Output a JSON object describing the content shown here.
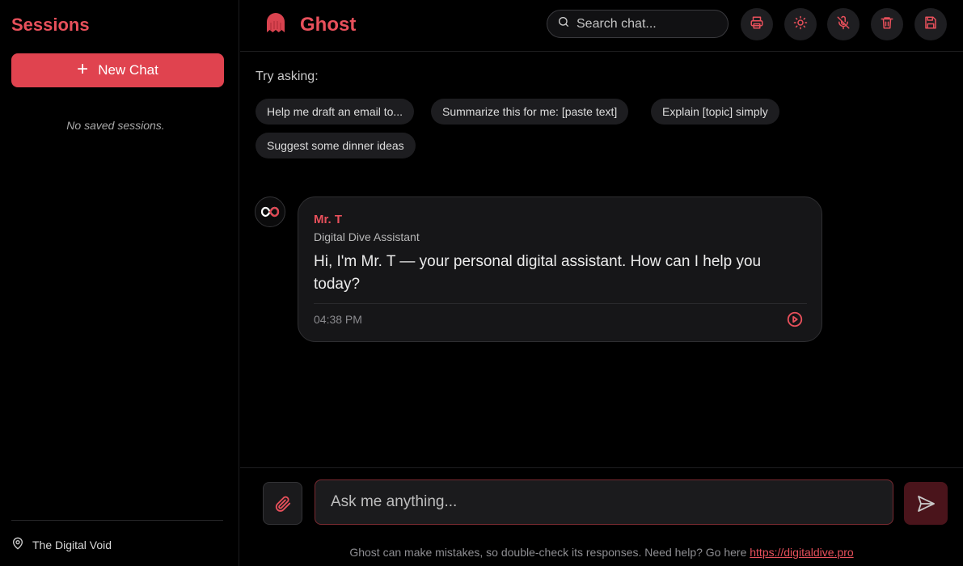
{
  "sidebar": {
    "title": "Sessions",
    "new_chat_label": "New Chat",
    "empty_text": "No saved sessions.",
    "location_label": "The Digital Void"
  },
  "header": {
    "app_name": "Ghost",
    "search_placeholder": "Search chat...",
    "actions": [
      "printer-icon",
      "sun-icon",
      "mic-off-icon",
      "trash-icon",
      "save-icon"
    ]
  },
  "suggestions": {
    "label": "Try asking:",
    "chips": [
      "Help me draft an email to...",
      "Summarize this for me: [paste text]",
      "Explain [topic] simply",
      "Suggest some dinner ideas"
    ]
  },
  "message": {
    "sender": "Mr. T",
    "role": "Digital Dive Assistant",
    "text": "Hi, I'm Mr. T — your personal digital assistant. How can I help you today?",
    "time": "04:38 PM"
  },
  "composer": {
    "placeholder": "Ask me anything...",
    "disclaimer": "Ghost can make mistakes, so double-check its responses. Need help? Go here ",
    "help_link": "https://digitaldive.pro"
  },
  "colors": {
    "accent": "#e8505b",
    "button": "#e0434f",
    "background": "#000000"
  }
}
